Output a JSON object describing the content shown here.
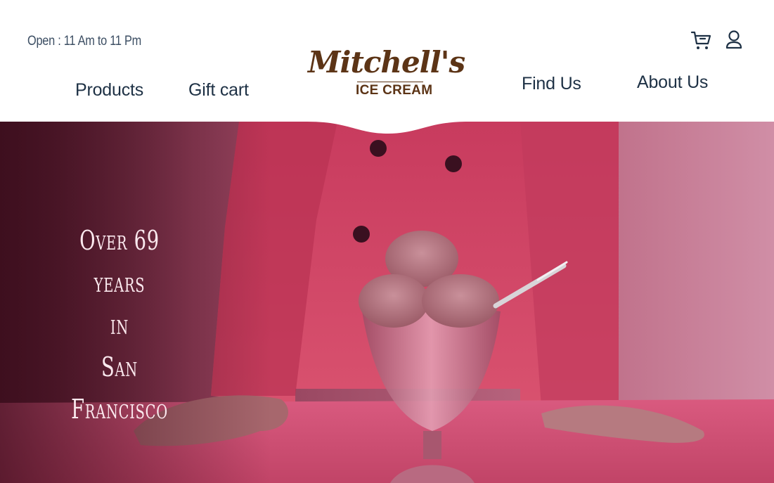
{
  "header": {
    "hours": "Open : 11 Am to 11 Pm",
    "nav": {
      "products": "Products",
      "gift": "Gift cart",
      "find": "Find Us",
      "about": "About Us"
    },
    "logo": {
      "script": "Mitchell's",
      "sub": "ICE CREAM"
    },
    "icons": [
      "cart-icon",
      "user-icon"
    ]
  },
  "hero": {
    "tagline": [
      "Over 69 years",
      "in",
      "San Francisco"
    ]
  },
  "colors": {
    "brand_brown": "#5c3416",
    "nav_text": "#1e3145",
    "hero_pink": "#d24d72"
  }
}
